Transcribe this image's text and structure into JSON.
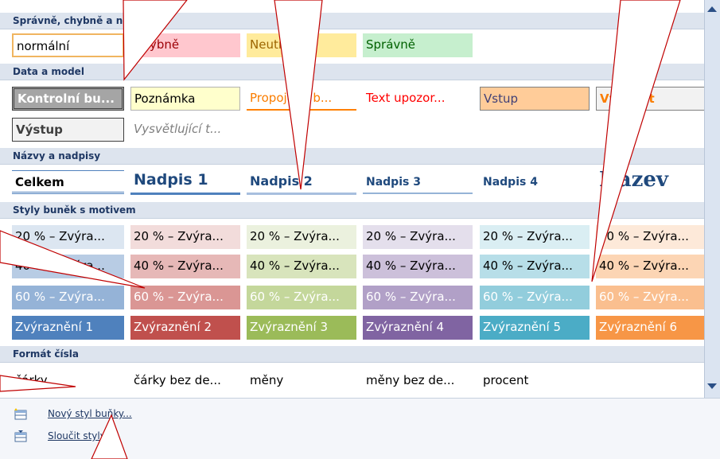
{
  "sections": {
    "good_bad": "Správně, chybně a neutrální",
    "data_model": "Data a model",
    "titles": "Názvy a nadpisy",
    "themed": "Styly buněk s motivem",
    "number_format": "Formát čísla"
  },
  "good_bad": [
    "normální",
    "Chybně",
    "Neutrální",
    "Správně"
  ],
  "data_model": [
    "Kontrolní bu...",
    "Poznámka",
    "Propojená b...",
    "Text upozor...",
    "Vstup",
    "Výpočet",
    "Výstup",
    "Vysvětlující t..."
  ],
  "titles": [
    "Celkem",
    "Nadpis 1",
    "Nadpis 2",
    "Nadpis 3",
    "Nadpis 4",
    "Název"
  ],
  "themed": {
    "row20": [
      "20 % – Zvýra...",
      "20 % – Zvýra...",
      "20 % – Zvýra...",
      "20 % – Zvýra...",
      "20 % – Zvýra...",
      "20 % – Zvýra..."
    ],
    "row40": [
      "40 % – Zvýra...",
      "40 % – Zvýra...",
      "40 % – Zvýra...",
      "40 % – Zvýra...",
      "40 % – Zvýra...",
      "40 % – Zvýra..."
    ],
    "row60": [
      "60 % – Zvýra...",
      "60 % – Zvýra...",
      "60 % – Zvýra...",
      "60 % – Zvýra...",
      "60 % – Zvýra...",
      "60 % – Zvýra..."
    ],
    "accent": [
      "Zvýraznění 1",
      "Zvýraznění 2",
      "Zvýraznění 3",
      "Zvýraznění 4",
      "Zvýraznění 5",
      "Zvýraznění 6"
    ]
  },
  "number_format": [
    "čárky",
    "čárky bez de...",
    "měny",
    "měny bez de...",
    "procent"
  ],
  "footer": {
    "new_style": "Nový styl buňky...",
    "merge_styles": "Sloučit styly..."
  },
  "colors": {
    "accent1": "#4f81bd",
    "accent2": "#c0504d",
    "accent3": "#9bbb59",
    "accent4": "#8064a2",
    "accent5": "#4bacc6",
    "accent6": "#f79646",
    "callout_fill": "#ffffff",
    "callout_line": "#c00000",
    "background": "#8b0d0d"
  },
  "icons": [
    "new-style-icon",
    "merge-styles-icon",
    "scroll-up-icon",
    "scroll-down-icon"
  ]
}
